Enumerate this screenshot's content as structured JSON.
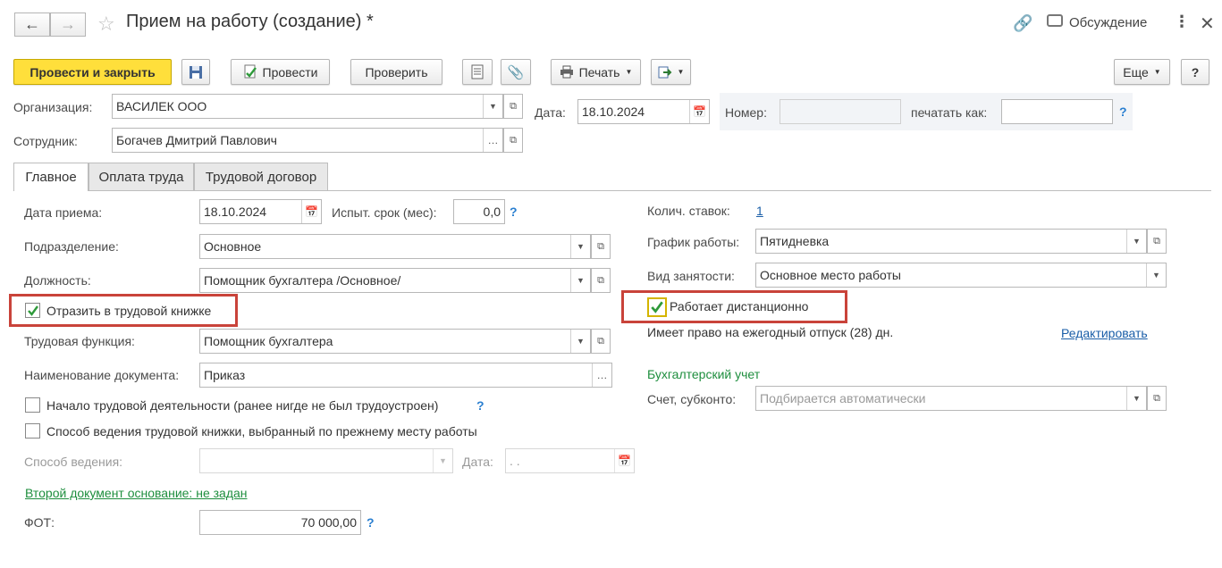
{
  "window": {
    "title": "Прием на работу (создание) *",
    "discussion_label": "Обсуждение"
  },
  "toolbar": {
    "post_close_label": "Провести и закрыть",
    "post_label": "Провести",
    "check_label": "Проверить",
    "print_label": "Печать",
    "more_label": "Еще",
    "help_label": "?"
  },
  "header": {
    "org_label": "Организация:",
    "org_value": "ВАСИЛЕК ООО",
    "employee_label": "Сотрудник:",
    "employee_value": "Богачев Дмитрий Павлович",
    "date_label": "Дата:",
    "date_value": "18.10.2024",
    "number_label": "Номер:",
    "number_value": "",
    "print_as_label": "печатать как:",
    "print_as_value": "",
    "help": "?"
  },
  "tabs": [
    {
      "label": "Главное"
    },
    {
      "label": "Оплата труда"
    },
    {
      "label": "Трудовой договор"
    }
  ],
  "left": {
    "hire_date_label": "Дата приема:",
    "hire_date_value": "18.10.2024",
    "probation_label": "Испыт. срок (мес):",
    "probation_value": "0,0",
    "help": "?",
    "department_label": "Подразделение:",
    "department_value": "Основное",
    "position_label": "Должность:",
    "position_value": "Помощник бухгалтера /Основное/",
    "workbook_checkbox_label": "Отразить в трудовой книжке",
    "labor_function_label": "Трудовая функция:",
    "labor_function_value": "Помощник бухгалтера",
    "doc_name_label": "Наименование документа:",
    "doc_name_value": "Приказ",
    "first_job_label": "Начало трудовой деятельности (ранее нигде не был трудоустроен)",
    "prev_method_label": "Способ ведения трудовой книжки, выбранный по прежнему месту работы",
    "method_label": "Способ ведения:",
    "method_value": "",
    "method_date_label": "Дата:",
    "method_date_value": " .  .",
    "second_doc_link": "Второй документ основание: не задан",
    "fot_label": "ФОТ:",
    "fot_value": "70 000,00"
  },
  "right": {
    "rates_label": "Колич. ставок:",
    "rates_value": "1",
    "schedule_label": "График работы:",
    "schedule_value": "Пятидневка",
    "employment_label": "Вид занятости:",
    "employment_value": "Основное место работы",
    "remote_label": "Работает дистанционно",
    "vacation_text": "Имеет право на ежегодный отпуск (28) дн.",
    "edit_link": "Редактировать",
    "accounting_title": "Бухгалтерский учет",
    "account_label": "Счет, субконто:",
    "account_placeholder": "Подбирается автоматически"
  },
  "colors": {
    "primary_button": "#ffdf3b",
    "highlight_frame": "#c9433a",
    "link": "#1a5ea8",
    "green_link": "#1e8e3e"
  }
}
